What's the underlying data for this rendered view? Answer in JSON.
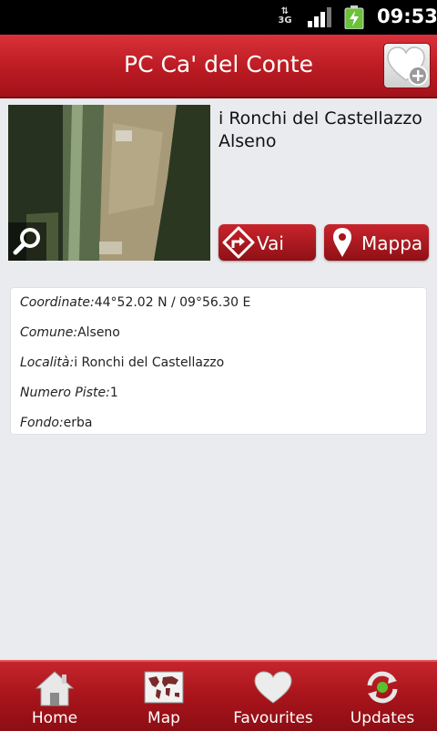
{
  "status_bar": {
    "network": "3G",
    "time": "09:53"
  },
  "header": {
    "title": "PC Ca' del Conte"
  },
  "place": {
    "name": "i Ronchi del Castellazzo",
    "town": "Alseno"
  },
  "actions": {
    "vai_label": "Vai",
    "mappa_label": "Mappa"
  },
  "details": [
    {
      "key": "Coordinate:",
      "value": "44°52.02  N / 09°56.30  E"
    },
    {
      "key": "Comune:",
      "value": "Alseno"
    },
    {
      "key": "Località:",
      "value": "i Ronchi del Castellazzo"
    },
    {
      "key": "Numero  Piste:",
      "value": "1"
    },
    {
      "key": "Fondo:",
      "value": "erba"
    }
  ],
  "bottom_nav": [
    {
      "label": "Home",
      "icon": "home-icon"
    },
    {
      "label": "Map",
      "icon": "world-map-icon"
    },
    {
      "label": "Favourites",
      "icon": "heart-icon"
    },
    {
      "label": "Updates",
      "icon": "refresh-icon"
    }
  ],
  "colors": {
    "brand_red": "#bb1b22",
    "background": "#e9ebee"
  }
}
